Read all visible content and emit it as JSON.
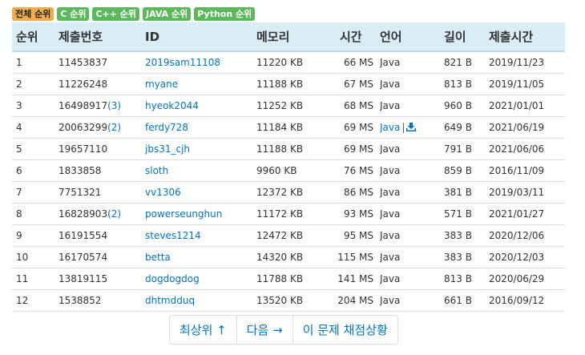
{
  "filters": [
    {
      "label": "전체 순위",
      "active": true
    },
    {
      "label": "C 순위",
      "active": false
    },
    {
      "label": "C++ 순위",
      "active": false
    },
    {
      "label": "JAVA 순위",
      "active": false
    },
    {
      "label": "Python 순위",
      "active": false
    }
  ],
  "table": {
    "headers": {
      "rank": "순위",
      "submission": "제출번호",
      "id": "ID",
      "memory": "메모리",
      "time": "시간",
      "language": "언어",
      "length": "길이",
      "submitted_at": "제출시간"
    },
    "rows": [
      {
        "rank": "1",
        "submission": "11453837",
        "extra": "",
        "id": "2019sam11108",
        "memory": "11220 KB",
        "time": "66 MS",
        "language": "Java",
        "download": false,
        "length": "821 B",
        "date": "2019/11/23"
      },
      {
        "rank": "2",
        "submission": "11226248",
        "extra": "",
        "id": "myane",
        "memory": "11188 KB",
        "time": "67 MS",
        "language": "Java",
        "download": false,
        "length": "813 B",
        "date": "2019/11/05"
      },
      {
        "rank": "3",
        "submission": "16498917",
        "extra": "(3)",
        "id": "hyeok2044",
        "memory": "11252 KB",
        "time": "68 MS",
        "language": "Java",
        "download": false,
        "length": "960 B",
        "date": "2021/01/01"
      },
      {
        "rank": "4",
        "submission": "20063299",
        "extra": "(2)",
        "id": "ferdy728",
        "memory": "11184 KB",
        "time": "69 MS",
        "language": "Java",
        "download": true,
        "length": "649 B",
        "date": "2021/06/19"
      },
      {
        "rank": "5",
        "submission": "19657110",
        "extra": "",
        "id": "jbs31_cjh",
        "memory": "11188 KB",
        "time": "69 MS",
        "language": "Java",
        "download": false,
        "length": "791 B",
        "date": "2021/06/06"
      },
      {
        "rank": "6",
        "submission": "1833858",
        "extra": "",
        "id": "sloth",
        "memory": "9960 KB",
        "time": "76 MS",
        "language": "Java",
        "download": false,
        "length": "859 B",
        "date": "2016/11/09"
      },
      {
        "rank": "7",
        "submission": "7751321",
        "extra": "",
        "id": "vv1306",
        "memory": "12372 KB",
        "time": "86 MS",
        "language": "Java",
        "download": false,
        "length": "381 B",
        "date": "2019/03/11"
      },
      {
        "rank": "8",
        "submission": "16828903",
        "extra": "(2)",
        "id": "powerseunghun",
        "memory": "11172 KB",
        "time": "93 MS",
        "language": "Java",
        "download": false,
        "length": "571 B",
        "date": "2021/01/27"
      },
      {
        "rank": "9",
        "submission": "16191554",
        "extra": "",
        "id": "steves1214",
        "memory": "12472 KB",
        "time": "95 MS",
        "language": "Java",
        "download": false,
        "length": "383 B",
        "date": "2020/12/06"
      },
      {
        "rank": "10",
        "submission": "16170574",
        "extra": "",
        "id": "betta",
        "memory": "14320 KB",
        "time": "115 MS",
        "language": "Java",
        "download": false,
        "length": "383 B",
        "date": "2020/12/03"
      },
      {
        "rank": "11",
        "submission": "13819115",
        "extra": "",
        "id": "dogdogdog",
        "memory": "11788 KB",
        "time": "141 MS",
        "language": "Java",
        "download": false,
        "length": "813 B",
        "date": "2020/06/29"
      },
      {
        "rank": "12",
        "submission": "1538852",
        "extra": "",
        "id": "dhtmdduq",
        "memory": "13520 KB",
        "time": "204 MS",
        "language": "Java",
        "download": false,
        "length": "661 B",
        "date": "2016/09/12"
      }
    ]
  },
  "pager": {
    "top_label": "최상위 ↑",
    "next_label": "다음 →",
    "status_label": "이 문제 채점상황"
  },
  "colors": {
    "header_bg": "#d9edf7",
    "link": "#0076c0",
    "badge_active": "#f0ad4e",
    "badge_green": "#5cb85c"
  },
  "icons": {
    "download": "download-icon"
  }
}
